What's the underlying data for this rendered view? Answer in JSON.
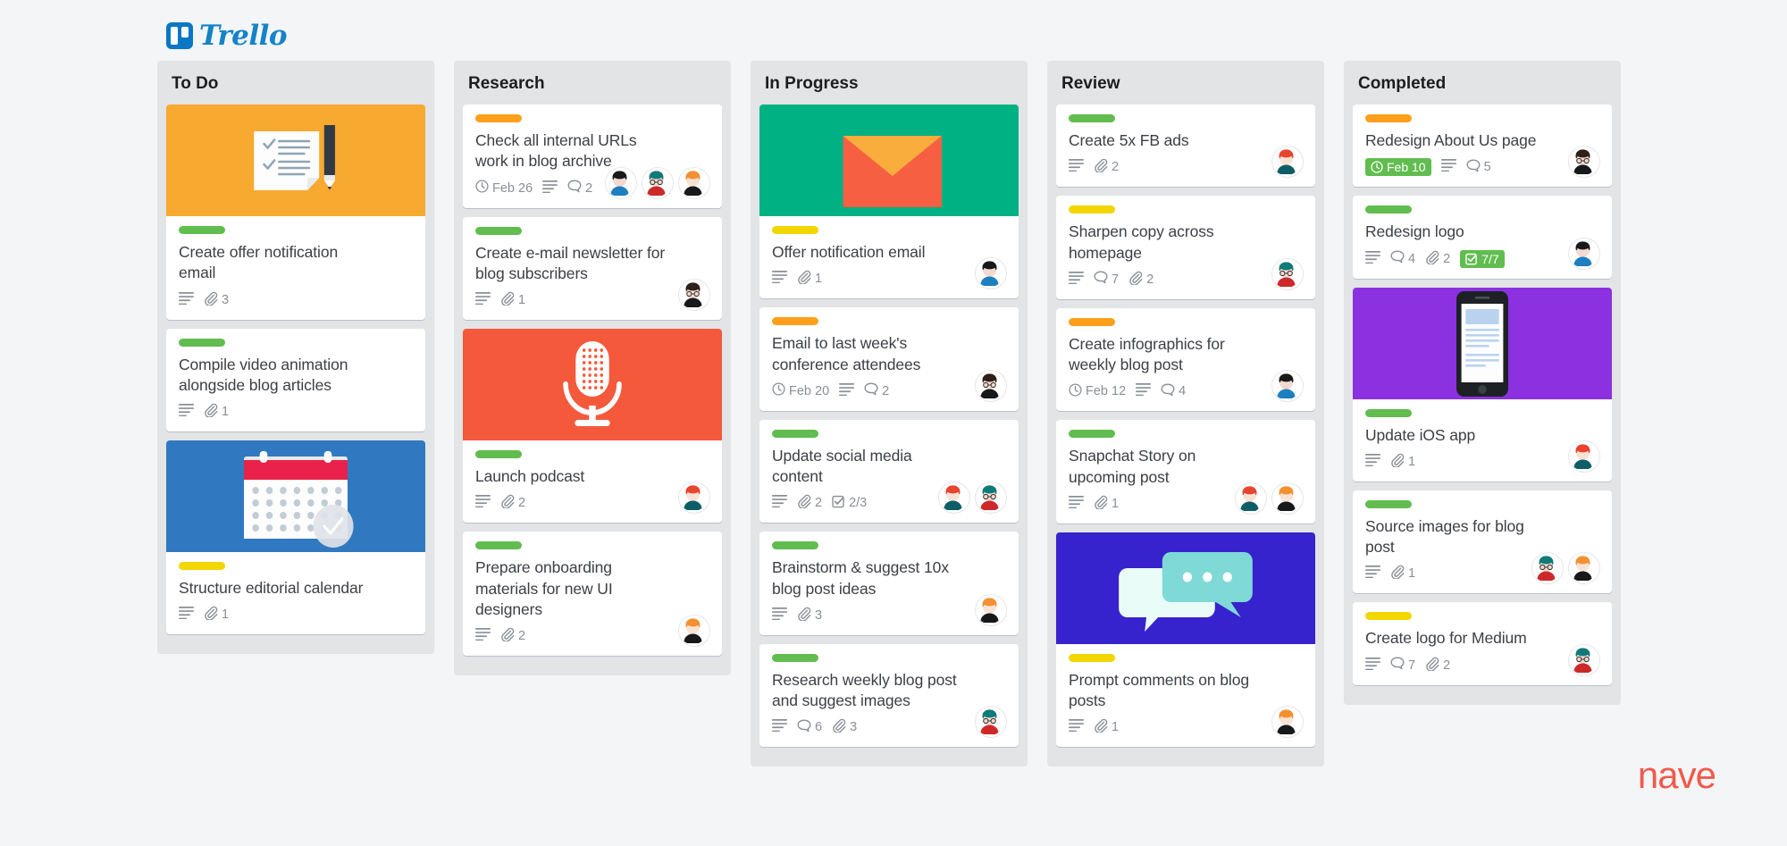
{
  "brand": {
    "name": "Trello",
    "watermark": "nave"
  },
  "colors": {
    "label_green": "#61bd4f",
    "label_yellow": "#f2d600",
    "label_orange": "#ff9f1a",
    "badge_done": "#61bd4f",
    "column_bg": "#e2e4e6",
    "page_bg": "#f4f5f7",
    "brand_blue": "#1483c8",
    "watermark_red": "#ef5b4c"
  },
  "columns": [
    {
      "title": "To Do",
      "cards": [
        {
          "cover": "checklist-notepad-pen",
          "cover_bg": "#f7a930",
          "label": "green",
          "title": "Create offer notification email",
          "description": true,
          "attachments": "3",
          "comments": null,
          "checklist": null,
          "due": null,
          "avatars": []
        },
        {
          "cover": null,
          "label": "green",
          "title": "Compile video animation alongside blog articles",
          "description": true,
          "attachments": "1",
          "comments": null,
          "checklist": null,
          "due": null,
          "avatars": []
        },
        {
          "cover": "calendar-check",
          "cover_bg": "#3079c0",
          "label": "yellow",
          "title": "Structure editorial calendar",
          "description": true,
          "attachments": "1",
          "comments": null,
          "checklist": null,
          "due": null,
          "avatars": []
        }
      ]
    },
    {
      "title": "Research",
      "cards": [
        {
          "cover": null,
          "label": "orange",
          "title": "Check all internal URLs work in blog archive",
          "description": true,
          "attachments": null,
          "comments": "2",
          "checklist": null,
          "due": "Feb 26",
          "due_done": false,
          "avatars": [
            "dark-hair-blue",
            "teal-hair-red",
            "orange-hair-dark"
          ]
        },
        {
          "cover": null,
          "label": "green",
          "title": "Create e-mail newsletter for blog subscribers",
          "description": true,
          "attachments": "1",
          "comments": null,
          "checklist": null,
          "due": null,
          "avatars": [
            "glasses-dark"
          ]
        },
        {
          "cover": "microphone",
          "cover_bg": "#f4593c",
          "label": "green",
          "title": "Launch podcast",
          "description": true,
          "attachments": "2",
          "comments": null,
          "checklist": null,
          "due": null,
          "avatars": [
            "red-hair-teal"
          ]
        },
        {
          "cover": null,
          "label": "green",
          "title": "Prepare onboarding materials for new UI designers",
          "description": true,
          "attachments": "2",
          "comments": null,
          "checklist": null,
          "due": null,
          "avatars": [
            "orange-hair-dark"
          ]
        }
      ]
    },
    {
      "title": "In Progress",
      "cards": [
        {
          "cover": "envelope",
          "cover_bg": "#00b183",
          "label": "yellow",
          "title": "Offer notification email",
          "description": true,
          "attachments": "1",
          "comments": null,
          "checklist": null,
          "due": null,
          "avatars": [
            "dark-hair-blue"
          ]
        },
        {
          "cover": null,
          "label": "orange",
          "title": "Email to last week's conference attendees",
          "description": true,
          "attachments": null,
          "comments": "2",
          "checklist": null,
          "due": "Feb 20",
          "due_done": false,
          "avatars": [
            "glasses-dark"
          ]
        },
        {
          "cover": null,
          "label": "green",
          "title": "Update social media content",
          "description": true,
          "attachments": "2",
          "comments": null,
          "checklist": "2/3",
          "checklist_done": false,
          "due": null,
          "avatars": [
            "red-hair-teal",
            "teal-hair-red"
          ]
        },
        {
          "cover": null,
          "label": "green",
          "title": "Brainstorm & suggest 10x blog post ideas",
          "description": true,
          "attachments": "3",
          "comments": null,
          "checklist": null,
          "due": null,
          "avatars": [
            "orange-hair-dark"
          ]
        },
        {
          "cover": null,
          "label": "green",
          "title": "Research weekly blog post and suggest images",
          "description": true,
          "attachments": "3",
          "comments": "6",
          "checklist": null,
          "due": null,
          "avatars": [
            "teal-hair-red"
          ]
        }
      ]
    },
    {
      "title": "Review",
      "cards": [
        {
          "cover": null,
          "label": "green",
          "title": "Create 5x FB ads",
          "description": true,
          "attachments": "2",
          "comments": null,
          "checklist": null,
          "due": null,
          "avatars": [
            "red-hair-teal"
          ]
        },
        {
          "cover": null,
          "label": "yellow",
          "title": "Sharpen copy across homepage",
          "description": true,
          "attachments": "2",
          "comments": "7",
          "checklist": null,
          "due": null,
          "avatars": [
            "teal-hair-red"
          ]
        },
        {
          "cover": null,
          "label": "orange",
          "title": "Create infographics for weekly blog post",
          "description": true,
          "attachments": null,
          "comments": "4",
          "checklist": null,
          "due": "Feb 12",
          "due_done": false,
          "avatars": [
            "dark-hair-blue"
          ]
        },
        {
          "cover": null,
          "label": "green",
          "title": "Snapchat Story on upcoming post",
          "description": true,
          "attachments": "1",
          "comments": null,
          "checklist": null,
          "due": null,
          "avatars": [
            "red-hair-teal",
            "orange-hair-dark"
          ]
        },
        {
          "cover": "speech-bubbles",
          "cover_bg": "#3723cd",
          "label": "yellow",
          "title": "Prompt comments on blog posts",
          "description": true,
          "attachments": "1",
          "comments": null,
          "checklist": null,
          "due": null,
          "avatars": [
            "orange-hair-dark"
          ]
        }
      ]
    },
    {
      "title": "Completed",
      "cards": [
        {
          "cover": null,
          "label": "orange",
          "title": "Redesign About Us page",
          "description": true,
          "attachments": null,
          "comments": "5",
          "checklist": null,
          "due": "Feb 10",
          "due_done": true,
          "avatars": [
            "glasses-dark"
          ]
        },
        {
          "cover": null,
          "label": "green",
          "title": "Redesign logo",
          "description": true,
          "attachments": "2",
          "comments": "4",
          "checklist": "7/7",
          "checklist_done": true,
          "due": null,
          "avatars": [
            "dark-hair-blue"
          ]
        },
        {
          "cover": "mobile-phone",
          "cover_bg": "#8b31e0",
          "label": "green",
          "title": "Update iOS app",
          "description": true,
          "attachments": "1",
          "comments": null,
          "checklist": null,
          "due": null,
          "avatars": [
            "red-hair-teal"
          ]
        },
        {
          "cover": null,
          "label": "green",
          "title": "Source images for blog post",
          "description": true,
          "attachments": "1",
          "comments": null,
          "checklist": null,
          "due": null,
          "avatars": [
            "teal-hair-red",
            "orange-hair-dark"
          ]
        },
        {
          "cover": null,
          "label": "yellow",
          "title": "Create logo for Medium",
          "description": true,
          "attachments": "2",
          "comments": "7",
          "checklist": null,
          "due": null,
          "avatars": [
            "teal-hair-red"
          ]
        }
      ]
    }
  ]
}
